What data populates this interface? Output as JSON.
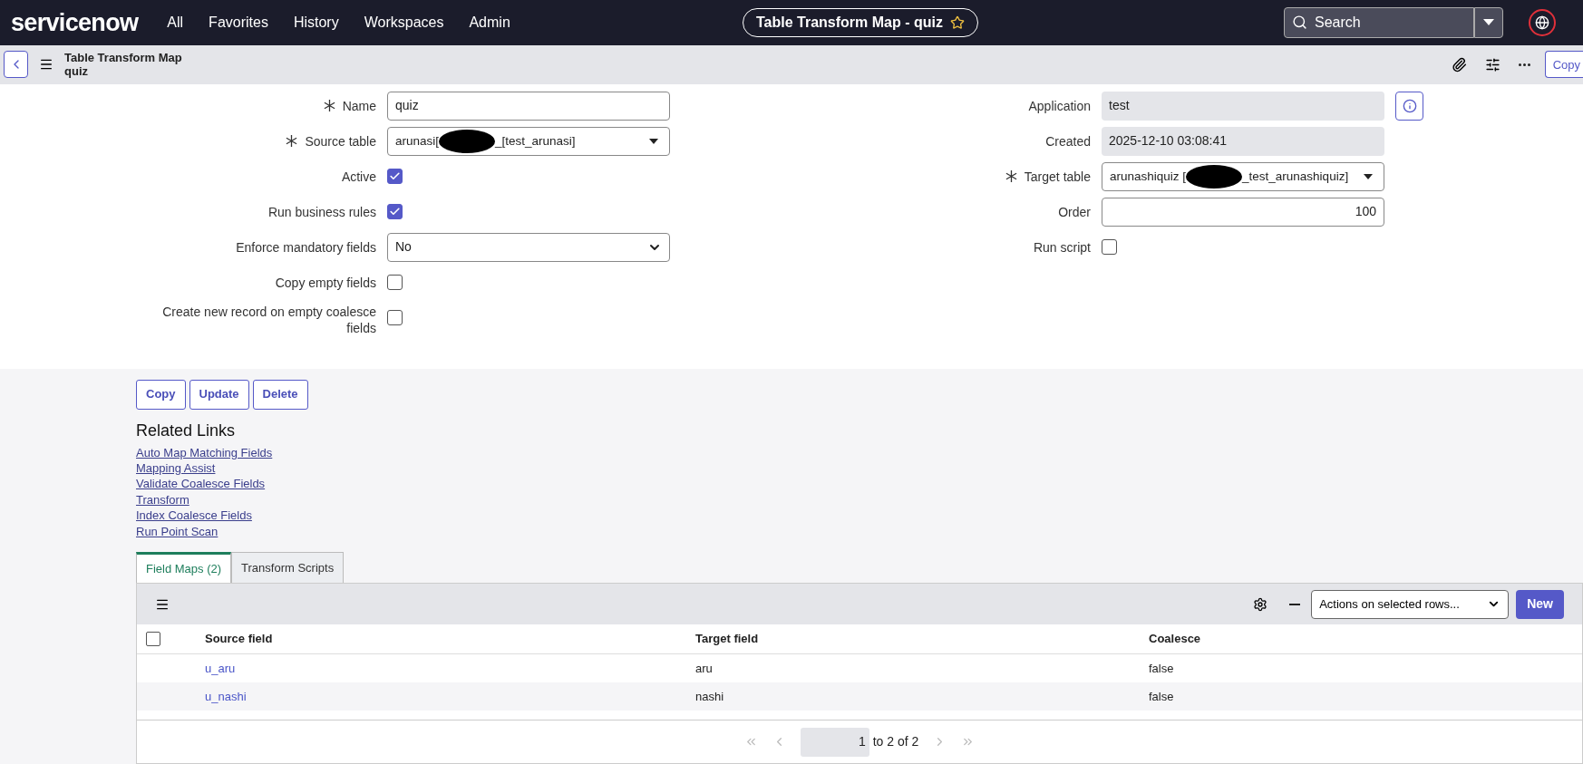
{
  "topnav": {
    "logo": "servicenow",
    "menu": [
      {
        "label": "All"
      },
      {
        "label": "Favorites"
      },
      {
        "label": "History"
      },
      {
        "label": "Workspaces"
      },
      {
        "label": "Admin"
      }
    ],
    "title_pill": "Table Transform Map - quiz",
    "search": {
      "placeholder": "Search"
    }
  },
  "header": {
    "title": "Table Transform Map",
    "subtitle": "quiz",
    "button": "Copy"
  },
  "form_left": [
    {
      "kind": "text",
      "label": "Name",
      "required": true,
      "value": "quiz"
    },
    {
      "kind": "reference",
      "label": "Source table",
      "required": true,
      "value_parts": [
        "arunasi[",
        "_[test_arunasi]"
      ]
    },
    {
      "kind": "checkbox",
      "label": "Active",
      "checked": true
    },
    {
      "kind": "checkbox",
      "label": "Run business rules",
      "checked": true
    },
    {
      "kind": "select",
      "label": "Enforce mandatory fields",
      "value": "No"
    },
    {
      "kind": "checkbox",
      "label": "Copy empty fields",
      "checked": false
    },
    {
      "kind": "checkbox",
      "label": "Create new record on empty coalesce fields",
      "checked": false
    }
  ],
  "form_right": [
    {
      "kind": "readonly",
      "label": "Application",
      "value": "test"
    },
    {
      "kind": "readonly",
      "label": "Created",
      "value": "2025-12-10 03:08:41"
    },
    {
      "kind": "reference",
      "label": "Target table",
      "required": true,
      "value_parts": [
        "arunashiquiz [",
        "_test_arunashiquiz]"
      ]
    },
    {
      "kind": "number",
      "label": "Order",
      "value": "100"
    },
    {
      "kind": "checkbox",
      "label": "Run script",
      "checked": false
    }
  ],
  "actions": [
    "Copy",
    "Update",
    "Delete"
  ],
  "related_links": {
    "title": "Related Links",
    "links": [
      "Auto Map Matching Fields",
      "Mapping Assist",
      "Validate Coalesce Fields",
      "Transform",
      "Index Coalesce Fields",
      "Run Point Scan"
    ]
  },
  "tabs": [
    {
      "label": "Field Maps (2)",
      "selected": true
    },
    {
      "label": "Transform Scripts",
      "selected": false
    }
  ],
  "list": {
    "select_all_checked": false,
    "actions_select": "Actions on selected rows...",
    "new_button": "New",
    "columns": [
      "Source field",
      "Target field",
      "Coalesce"
    ],
    "rows": [
      {
        "cells": [
          "u_aru",
          "aru",
          "false"
        ]
      },
      {
        "cells": [
          "u_nashi",
          "nashi",
          "false"
        ]
      }
    ],
    "pagination": {
      "page": "1",
      "range": "to 2 of 2"
    }
  }
}
